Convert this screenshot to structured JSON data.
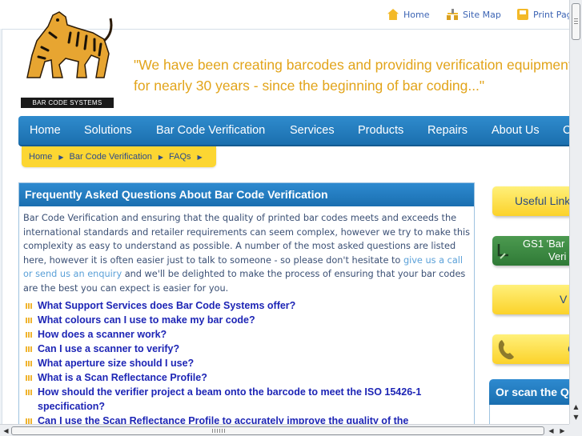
{
  "toplinks": {
    "home": "Home",
    "sitemap": "Site Map",
    "print": "Print Page"
  },
  "logo": {
    "text": "BAR CODE SYSTEMS"
  },
  "tagline": {
    "line1": "\"We have been creating barcodes and providing verification equipment",
    "line2": "for nearly 30 years - since the beginning of bar coding...\""
  },
  "nav": [
    "Home",
    "Solutions",
    "Bar Code Verification",
    "Services",
    "Products",
    "Repairs",
    "About Us",
    "Contact"
  ],
  "breadcrumb": [
    "Home",
    "Bar Code Verification",
    "FAQs"
  ],
  "panel": {
    "title": "Frequently Asked Questions About Bar Code Verification",
    "intro_before": "Bar Code Verification and ensuring that the quality of printed bar codes meets and exceeds the international standards and retailer requirements can seem complex, however we try to make this complexity as easy to understand as possible. A number of the most asked questions are listed here, however it is often easier just to talk to someone - so please don't hesitate to ",
    "intro_link": "give us a call or send us an enquiry",
    "intro_after": " and we'll be delighted to make the process of ensuring that your bar codes are the best you can expect is easier for you.",
    "questions": [
      "What Support Services does Bar Code Systems offer?",
      "What colours can I use to make my bar code?",
      "How does a scanner work?",
      "Can I use a scanner to verify?",
      "What aperture size should I use?",
      "What is a Scan Reflectance Profile?",
      "How should the verifier project a beam onto the barcode to meet the ISO 15426-1 specification?",
      "Can I use the Scan Reflectance Profile to accurately improve the quality of the"
    ]
  },
  "sidebar": {
    "useful_links": "Useful Links",
    "gs1_line1": "GS1 'Bar",
    "gs1_line2": "Veri",
    "v_text": "V",
    "phone_text": "C",
    "scan_header": "Or scan the QR"
  },
  "colors": {
    "accent_blue": "#1f78bd",
    "gold": "#e2a41a",
    "crumb_yellow": "#fcd632",
    "question_blue": "#1d25b5"
  }
}
